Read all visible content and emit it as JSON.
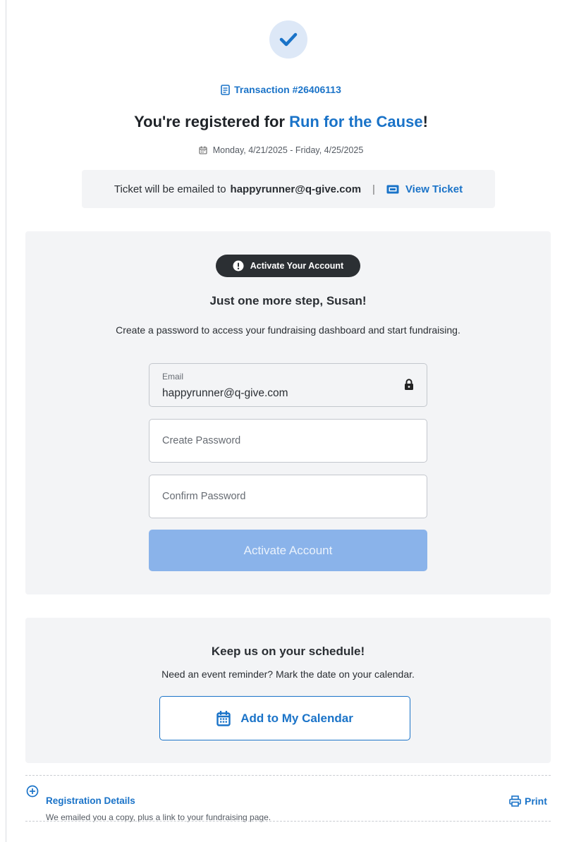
{
  "confirmation": {
    "transaction_label": "Transaction #26406113",
    "headline_prefix": "You're registered for ",
    "event_name": "Run for the Cause",
    "headline_suffix": "!",
    "dates": "Monday, 4/21/2025 - Friday, 4/25/2025"
  },
  "ticket": {
    "emailed_prefix": "Ticket will be emailed to",
    "email": "happyrunner@q-give.com",
    "separator": "|",
    "view_label": "View Ticket"
  },
  "activation": {
    "badge_label": "Activate Your Account",
    "title": "Just one more step, Susan!",
    "description": "Create a password to access your fundraising dashboard and start fundraising.",
    "email_label": "Email",
    "email_value": "happyrunner@q-give.com",
    "create_password_placeholder": "Create Password",
    "confirm_password_placeholder": "Confirm Password",
    "button_label": "Activate Account"
  },
  "schedule": {
    "title": "Keep us on your schedule!",
    "description": "Need an event reminder? Mark the date on your calendar.",
    "button_label": "Add to My Calendar"
  },
  "registration": {
    "title": "Registration Details",
    "description": "We emailed you a copy, plus a link to your fundraising page.",
    "print_label": "Print"
  },
  "colors": {
    "accent": "#1a73c8",
    "disabled_button": "#8ab3ea",
    "panel_bg": "#f3f4f6",
    "badge_bg": "#2b2f33"
  }
}
